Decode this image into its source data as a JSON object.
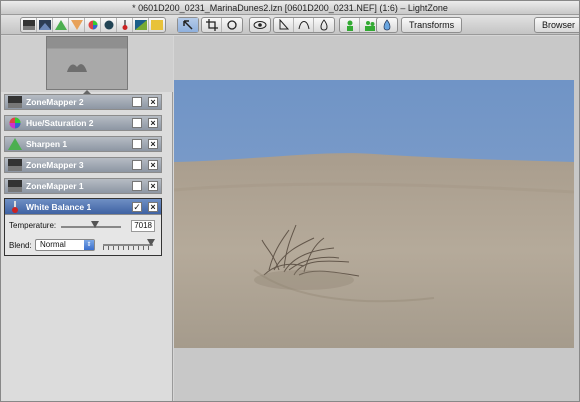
{
  "window": {
    "title": "* 0601D200_0231_MarinaDunes2.lzn [0601D200_0231.NEF] (1:6) – LightZone"
  },
  "toolbar": {
    "tool_icons": [
      "zonemapper-icon",
      "relight-icon",
      "sharpen-icon",
      "blur-icon",
      "hue-saturation-icon",
      "color-balance-icon",
      "white-balance-icon",
      "channel-mixer-icon",
      "noise-icon"
    ],
    "edit_icons": [
      "arrow-icon",
      "crop-icon",
      "rotate-icon",
      "eye-icon",
      "region-polygon-icon",
      "region-spline-icon",
      "region-brush-icon",
      "one-person-icon",
      "two-people-icon",
      "dropper-icon"
    ],
    "transforms_label": "Transforms",
    "browser_label": "Browser"
  },
  "tools": [
    {
      "name": "ZoneMapper 2",
      "icon": "zonemapper-icon",
      "enabled": false
    },
    {
      "name": "Hue/Saturation 2",
      "icon": "hue-saturation-icon",
      "enabled": false
    },
    {
      "name": "Sharpen 1",
      "icon": "sharpen-icon",
      "enabled": false
    },
    {
      "name": "ZoneMapper 3",
      "icon": "zonemapper-icon",
      "enabled": false
    },
    {
      "name": "ZoneMapper 1",
      "icon": "zonemapper-icon",
      "enabled": false
    }
  ],
  "white_balance": {
    "name": "White Balance 1",
    "enabled": true,
    "temperature_label": "Temperature:",
    "temperature_value": "7018",
    "blend_label": "Blend:",
    "blend_value": "Normal",
    "check_mark": "✓",
    "close_mark": "×",
    "select_arrow": "⇕"
  },
  "colors": {
    "sky": "#7c9cc8",
    "sand": "#b3a898",
    "accent": "#4a6db0"
  }
}
